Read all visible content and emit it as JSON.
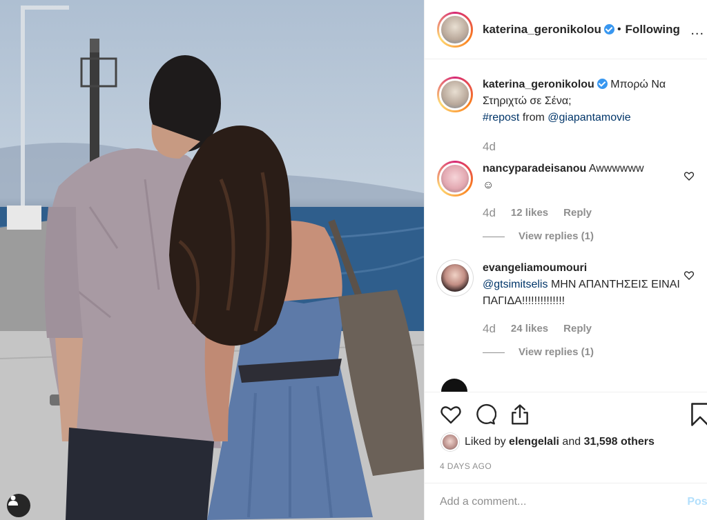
{
  "header": {
    "username": "katerina_geronikolou",
    "follow_state": "Following",
    "separator": "•",
    "more": "..."
  },
  "caption": {
    "username": "katerina_geronikolou",
    "text": "Μπορώ Να Στηριχτώ σε Σένα;",
    "hashtag": "#repost",
    "from_text": "from",
    "mention": "@giapantamovie",
    "time": "4d"
  },
  "comments": [
    {
      "username": "nancyparadeisanou",
      "text": "Awwwwww",
      "emoji": "☺",
      "time": "4d",
      "likes": "12 likes",
      "reply": "Reply",
      "view_replies": "View replies (1)"
    },
    {
      "username": "evangeliamoumouri",
      "mention": "@gtsimitselis",
      "text": "ΜΗΝ ΑΠΑΝΤΗΣΕΙΣ ΕΙΝΑΙ ΠΑΓΙΔΑ!!!!!!!!!!!!!!",
      "time": "4d",
      "likes": "24 likes",
      "reply": "Reply",
      "view_replies": "View replies (1)"
    }
  ],
  "likes": {
    "prefix": "Liked by",
    "user": "elengelali",
    "and": "and",
    "others": "31,598 others"
  },
  "post_date": "4 DAYS AGO",
  "add_comment": {
    "placeholder": "Add a comment...",
    "post_label": "Post"
  },
  "icons": {
    "like": "heart-icon",
    "comment": "comment-icon",
    "share": "share-icon",
    "save": "bookmark-icon",
    "user_tag": "user-tag-icon"
  },
  "colors": {
    "link": "#003569",
    "verified": "#3897f0",
    "muted": "#8e8e8e",
    "post_button": "#b2dffc"
  }
}
